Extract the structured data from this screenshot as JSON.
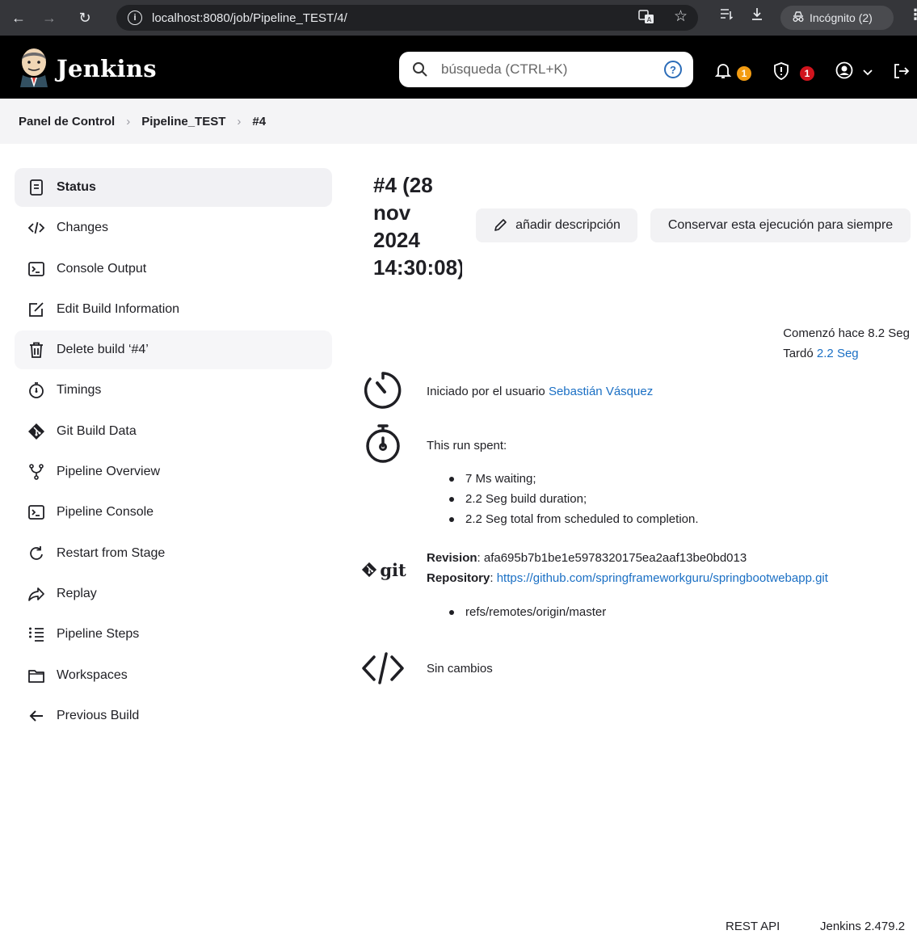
{
  "browser": {
    "url": "localhost:8080/job/Pipeline_TEST/4/",
    "incognito_label": "Incógnito (2)"
  },
  "header": {
    "brand": "Jenkins",
    "search_placeholder": "búsqueda (CTRL+K)",
    "help_glyph": "?",
    "notifications_count": "1",
    "security_count": "1",
    "colors": {
      "notifications_badge": "#f39c12",
      "security_badge": "#d1141d"
    }
  },
  "breadcrumb": {
    "items": [
      "Panel de Control",
      "Pipeline_TEST",
      "#4"
    ],
    "separator": "›"
  },
  "sidebar": {
    "items": [
      {
        "label": "Status",
        "icon": "status-document-icon"
      },
      {
        "label": "Changes",
        "icon": "code-brackets-icon"
      },
      {
        "label": "Console Output",
        "icon": "terminal-icon"
      },
      {
        "label": "Edit Build Information",
        "icon": "edit-note-icon"
      },
      {
        "label": "Delete build ‘#4’",
        "icon": "trash-icon"
      },
      {
        "label": "Timings",
        "icon": "stopwatch-icon"
      },
      {
        "label": "Git Build Data",
        "icon": "git-logo-icon"
      },
      {
        "label": "Pipeline Overview",
        "icon": "branch-icon"
      },
      {
        "label": "Pipeline Console",
        "icon": "terminal-icon"
      },
      {
        "label": "Restart from Stage",
        "icon": "redo-arrow-icon"
      },
      {
        "label": "Replay",
        "icon": "replay-arrow-icon"
      },
      {
        "label": "Pipeline Steps",
        "icon": "list-steps-icon"
      },
      {
        "label": "Workspaces",
        "icon": "folder-icon"
      },
      {
        "label": "Previous Build",
        "icon": "arrow-left-icon"
      }
    ]
  },
  "main": {
    "build_title": "#4 (28 nov 2024 14:30:08)",
    "add_description_label": "añadir descripción",
    "keep_forever_label": "Conservar esta ejecución para siempre",
    "started_text": "Comenzó hace 8.2 Seg",
    "took_prefix": "Tardó ",
    "took_link": "2.2 Seg",
    "started_by_prefix": "Iniciado por el usuario ",
    "started_by_user": "Sebastián Vásquez",
    "run_spent_heading": "This run spent:",
    "run_spent_items": [
      "7 Ms waiting;",
      "2.2 Seg build duration;",
      "2.2 Seg total from scheduled to completion."
    ],
    "git_logo_text": "git",
    "revision_label": "Revision",
    "revision_value": ": afa695b7b1be1e5978320175ea2aaf13be0bd013",
    "repository_label": "Repository",
    "repository_separator": ": ",
    "repository_url": "https://github.com/springframeworkguru/springbootwebapp.git",
    "refs": [
      "refs/remotes/origin/master"
    ],
    "changes_text": "Sin cambios"
  },
  "footer": {
    "rest_api": "REST API",
    "version": "Jenkins 2.479.2"
  }
}
